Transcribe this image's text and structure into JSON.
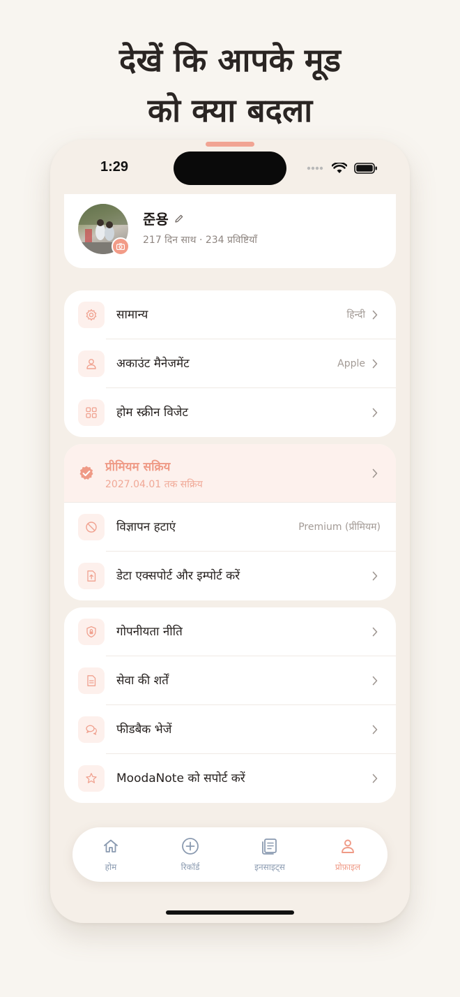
{
  "headline": {
    "line1": "देखें कि आपके मूड",
    "line2": "को क्या बदला"
  },
  "status_bar": {
    "time": "1:29"
  },
  "profile": {
    "name": "준용",
    "subtitle": "217 दिन साथ · 234 प्रविष्टियाँ"
  },
  "group1": [
    {
      "icon": "gear-icon",
      "label": "सामान्य",
      "value": "हिन्दी"
    },
    {
      "icon": "user-icon",
      "label": "अकाउंट मैनेजमेंट",
      "value": "Apple"
    },
    {
      "icon": "widget-grid-icon",
      "label": "होम स्क्रीन विजेट",
      "value": ""
    }
  ],
  "premium": {
    "title": "प्रीमियम सक्रिय",
    "subtitle": "2027.04.01 तक सक्रिय"
  },
  "group2": [
    {
      "icon": "no-ads-icon",
      "label": "विज्ञापन हटाएं",
      "value": "Premium (प्रीमियम)"
    },
    {
      "icon": "export-file-icon",
      "label": "डेटा एक्सपोर्ट और इम्पोर्ट करें",
      "value": ""
    }
  ],
  "group3": [
    {
      "icon": "shield-lock-icon",
      "label": "गोपनीयता नीति"
    },
    {
      "icon": "document-icon",
      "label": "सेवा की शर्तें"
    },
    {
      "icon": "chat-bubbles-icon",
      "label": "फीडबैक भेजें"
    },
    {
      "icon": "star-icon",
      "label": "MoodaNote को सपोर्ट करें"
    }
  ],
  "tabs": [
    {
      "icon": "home-icon",
      "label": "होम"
    },
    {
      "icon": "plus-circle-icon",
      "label": "रिकॉर्ड"
    },
    {
      "icon": "insights-icon",
      "label": "इनसाइट्स"
    },
    {
      "icon": "profile-icon",
      "label": "प्रोफ़ाइल"
    }
  ],
  "colors": {
    "accent": "#EF9A86",
    "background": "#F8F5F0",
    "tab_inactive": "#8A9AB0"
  }
}
